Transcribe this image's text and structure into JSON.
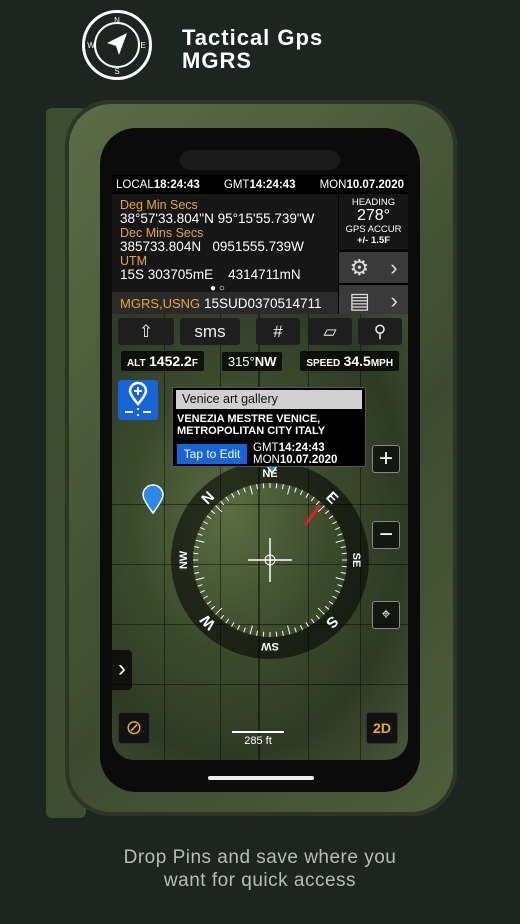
{
  "header": {
    "title_line1": "Tactical Gps",
    "title_line2": "MGRS",
    "logo_letters": [
      "N",
      "E",
      "S",
      "W"
    ]
  },
  "status": {
    "local_label": "LOCAL",
    "local_time": "18:24:43",
    "gmt_label": "GMT",
    "gmt_time": "14:24:43",
    "day": "MON",
    "date": "10.07.2020"
  },
  "coords": {
    "dms_label": "Deg Min Secs",
    "dms_value": "38°57'33.804\"N 95°15'55.739\"W",
    "dm_label": "Dec Mins Secs",
    "dm_value": "385733.804N   0951555.739W",
    "utm_label": "UTM",
    "utm_value": "15S 303705mE    4314711mN",
    "mgrs_label": "MGRS,USNG",
    "mgrs_value": "15SUD0370514711",
    "page_dots": "● ○"
  },
  "heading": {
    "label": "HEADING",
    "value": "278°",
    "accur_label": "GPS ACCUR",
    "accur_value": "+/- 1.5F"
  },
  "toolbar": {
    "sms_label": "sms"
  },
  "readouts": {
    "alt_label": "ALT",
    "alt_value": "1452.2",
    "alt_unit": "F",
    "bearing": "315°",
    "bearing_dir": "NW",
    "speed_label": "SPEED",
    "speed_value": "34.5",
    "speed_unit": "MPH"
  },
  "popup": {
    "name": "Venice art gallery",
    "address": "VENEZIA MESTRE VENICE, METROPOLITAN CITY  ITALY",
    "edit_label": "Tap to Edit",
    "gmt_label": "GMT",
    "gmt_time": "14:24:43",
    "day": "MON",
    "date": "10.07.2020"
  },
  "map": {
    "scale": "285 ft",
    "mode_label": "2D",
    "zoom_in": "+",
    "zoom_out": "−",
    "compass_labels": [
      "N",
      "NE",
      "E",
      "SE",
      "S",
      "SW",
      "W",
      "NW"
    ]
  },
  "caption": {
    "line1": "Drop Pins and save where you",
    "line2": "want for quick access"
  },
  "colors": {
    "accent_orange": "#e8a630",
    "accent_blue": "#1565d8",
    "case_green": "#4f5e3c"
  }
}
